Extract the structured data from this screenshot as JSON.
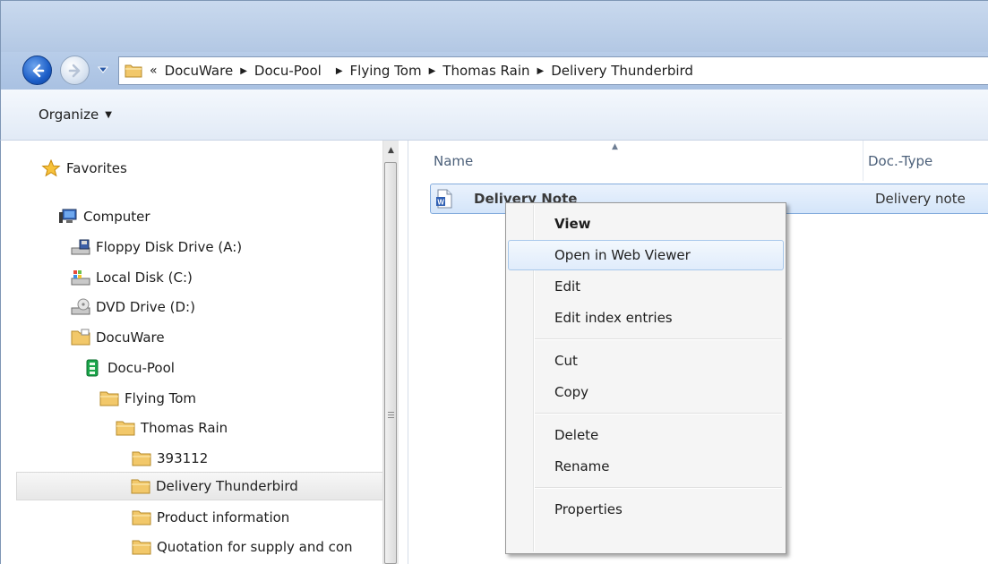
{
  "address_bar": {
    "overflow_glyph": "«",
    "breadcrumbs": [
      "DocuWare",
      "Docu-Pool",
      "Flying Tom",
      "Thomas Rain",
      "Delivery Thunderbird"
    ]
  },
  "toolbar": {
    "organize_label": "Organize"
  },
  "nav_tree": {
    "favorites": "Favorites",
    "computer": "Computer",
    "floppy": "Floppy Disk Drive (A:)",
    "local_disk": "Local Disk (C:)",
    "dvd": "DVD Drive (D:)",
    "docuware": "DocuWare",
    "docu_pool": "Docu-Pool",
    "flying_tom": "Flying Tom",
    "thomas_rain": "Thomas Rain",
    "folder_393112": "393112",
    "delivery_thunderbird": "Delivery Thunderbird",
    "product_information": "Product information",
    "quotation": "Quotation for supply and con"
  },
  "file_list": {
    "columns": [
      "Name",
      "Doc.-Type"
    ],
    "rows": [
      {
        "name": "Delivery Note",
        "doctype": "Delivery note"
      }
    ]
  },
  "context_menu": {
    "items": [
      "View",
      "Open in Web Viewer",
      "Edit",
      "Edit index entries",
      "Cut",
      "Copy",
      "Delete",
      "Rename",
      "Properties"
    ]
  },
  "colors": {
    "accent": "#1d5fc8",
    "selection": "#d4e5fa"
  }
}
